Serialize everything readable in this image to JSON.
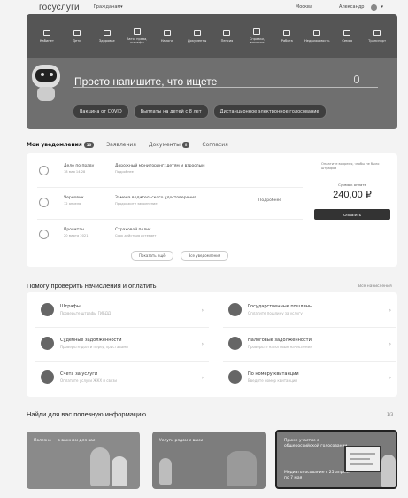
{
  "header": {
    "logo": "госуслуги",
    "user_type": "Гражданам",
    "region": "Москва",
    "user_name": "Александр"
  },
  "hero": {
    "categories": [
      {
        "label": "Кабинет",
        "icon": "user-icon"
      },
      {
        "label": "Дети",
        "icon": "child-icon"
      },
      {
        "label": "Здоровье",
        "icon": "health-icon"
      },
      {
        "label": "Авто, права, штрафы",
        "icon": "car-icon"
      },
      {
        "label": "Налоги",
        "icon": "tax-icon"
      },
      {
        "label": "Документы",
        "icon": "document-icon"
      },
      {
        "label": "Пенсия",
        "icon": "pension-icon"
      },
      {
        "label": "Справки, выписки",
        "icon": "certificate-icon"
      },
      {
        "label": "Работа",
        "icon": "work-icon"
      },
      {
        "label": "Недвижимость",
        "icon": "house-icon"
      },
      {
        "label": "Семья",
        "icon": "family-icon"
      },
      {
        "label": "Транспорт",
        "icon": "transport-icon"
      }
    ],
    "search_placeholder": "Просто напишите, что ищете",
    "chips": [
      "Вакцина от COVID",
      "Выплаты на детей с 8 лет",
      "Дистанционное электронное голосование"
    ]
  },
  "notifications": {
    "tabs": [
      {
        "label": "Мои уведомления",
        "badge": "10"
      },
      {
        "label": "Заявления",
        "badge": ""
      },
      {
        "label": "Документы",
        "badge": "8"
      },
      {
        "label": "Согласия",
        "badge": ""
      }
    ],
    "items": [
      {
        "org": "Дело по праву",
        "date": "18 мая 14:28",
        "title": "Дорожный мониторинг: детям и взрослым",
        "subtitle": "Подробнее",
        "action": ""
      },
      {
        "org": "Черновик",
        "date": "12 апреля",
        "title": "Замена водительского удостоверения",
        "subtitle": "Продолжите заполнение",
        "action": "Подробнее"
      },
      {
        "org": "Прочитан",
        "date": "20 марта 2021",
        "title": "Страховой полис",
        "subtitle": "Срок действия истекает",
        "action": ""
      }
    ],
    "pay_note": "Оплатите вовремя, чтобы не было штрафов",
    "pay_label": "Сумма к оплате",
    "pay_amount": "240,00 ₽",
    "pay_button": "Оплатить",
    "more": [
      "Показать ещё",
      "Все уведомления"
    ]
  },
  "check": {
    "title": "Помогу проверить начисления и оплатить",
    "all_link": "Все начисления",
    "tiles": [
      {
        "title": "Штрафы",
        "subtitle": "Проверьте штрафы ГИБДД",
        "icon": "fine-icon"
      },
      {
        "title": "Государственные пошлины",
        "subtitle": "Оплатите пошлину за услугу",
        "icon": "duty-icon"
      },
      {
        "title": "Судебные задолженности",
        "subtitle": "Проверьте долги перед приставами",
        "icon": "court-icon"
      },
      {
        "title": "Налоговые задолженности",
        "subtitle": "Проверьте налоговые начисления",
        "icon": "tax-icon"
      },
      {
        "title": "Счета за услуги",
        "subtitle": "Оплатите услуги ЖКХ и связи",
        "icon": "bill-icon"
      },
      {
        "title": "По номеру квитанции",
        "subtitle": "Введите номер квитанции",
        "icon": "receipt-icon"
      }
    ]
  },
  "useful": {
    "title": "Найди для вас полезную информацию",
    "pager": "1/3",
    "banners": [
      {
        "title": "Полезно — о важном для вас"
      },
      {
        "title": "Услуги рядом с вами"
      },
      {
        "title": "Прими участие в общероссийской голосовании",
        "subtitle": "Медиаголосование с 25 апреля по 7 мая"
      }
    ]
  },
  "colors": {
    "hero": "#6f6f6f",
    "strip": "#555555",
    "card": "#ffffff",
    "background": "#f3f3f3"
  }
}
